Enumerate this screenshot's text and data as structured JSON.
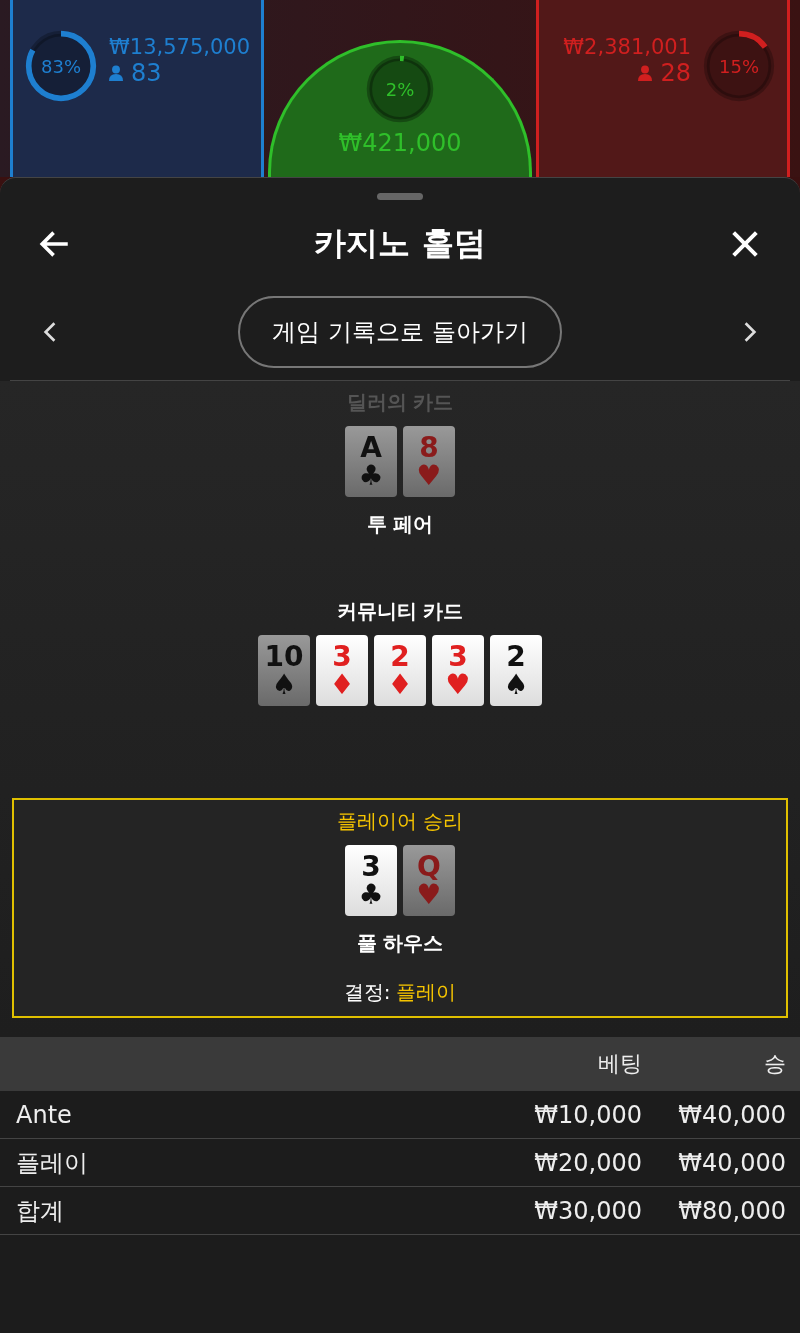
{
  "bet_spots": [
    {
      "kind": "left",
      "percent": "83%",
      "amount": "₩13,575,000",
      "players": "83",
      "color": "#1e7fd0"
    },
    {
      "kind": "center",
      "percent": "2%",
      "amount": "₩421,000",
      "color": "#2fbf2a"
    },
    {
      "kind": "right",
      "percent": "15%",
      "amount": "₩2,381,001",
      "players": "28",
      "color": "#d01f1f"
    }
  ],
  "sheet": {
    "title": "카지노 홀덤",
    "nav_button": "게임 기록으로 돌아가기"
  },
  "hands": [
    {
      "label": "딜러의 카드",
      "winner": false,
      "cards": [
        {
          "rank": "A",
          "suit": "♣",
          "red": false,
          "highlighted": false
        },
        {
          "rank": "8",
          "suit": "♥",
          "red": true,
          "highlighted": false
        }
      ],
      "result": "투 페어"
    },
    {
      "label": "커뮤니티 카드",
      "winner": false,
      "cards": [
        {
          "rank": "10",
          "suit": "♠",
          "red": false,
          "highlighted": false
        },
        {
          "rank": "3",
          "suit": "♦",
          "red": true,
          "highlighted": true
        },
        {
          "rank": "2",
          "suit": "♦",
          "red": true,
          "highlighted": true
        },
        {
          "rank": "3",
          "suit": "♥",
          "red": true,
          "highlighted": true
        },
        {
          "rank": "2",
          "suit": "♠",
          "red": false,
          "highlighted": true
        }
      ]
    },
    {
      "label": "플레이어 승리",
      "winner": true,
      "cards": [
        {
          "rank": "3",
          "suit": "♣",
          "red": false,
          "highlighted": true
        },
        {
          "rank": "Q",
          "suit": "♥",
          "red": true,
          "highlighted": false
        }
      ],
      "result": "풀 하우스",
      "decision_label": "결정:",
      "decision_value": "플레이"
    }
  ],
  "table": {
    "columns": [
      "베팅",
      "승"
    ],
    "rows": [
      {
        "name": "Ante",
        "bet": "₩10,000",
        "win": "₩40,000"
      },
      {
        "name": "플레이",
        "bet": "₩20,000",
        "win": "₩40,000"
      },
      {
        "name": "합계",
        "bet": "₩30,000",
        "win": "₩80,000"
      }
    ]
  }
}
